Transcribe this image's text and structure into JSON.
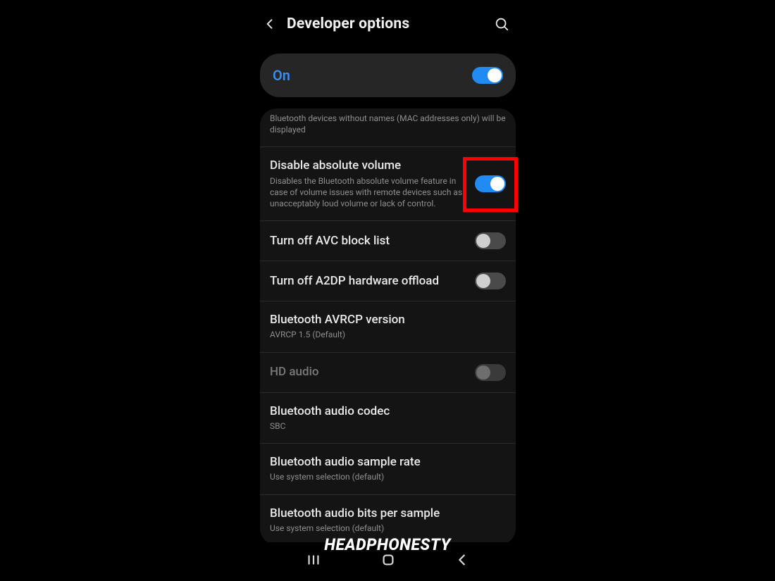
{
  "header": {
    "title": "Developer options"
  },
  "master": {
    "label": "On",
    "on": true
  },
  "rows": {
    "bt_noname_sub": "Bluetooth devices without names (MAC addresses only) will be displayed",
    "disable_abs": {
      "title": "Disable absolute volume",
      "sub": "Disables the Bluetooth absolute volume feature in case of volume issues with remote devices such as unacceptably loud volume or lack of control."
    },
    "avc": {
      "title": "Turn off AVC block list"
    },
    "a2dp": {
      "title": "Turn off A2DP hardware offload"
    },
    "avrcp": {
      "title": "Bluetooth AVRCP version",
      "sub": "AVRCP 1.5 (Default)"
    },
    "hd": {
      "title": "HD audio"
    },
    "codec": {
      "title": "Bluetooth audio codec",
      "sub": "SBC"
    },
    "sample": {
      "title": "Bluetooth audio sample rate",
      "sub": "Use system selection (default)"
    },
    "bits": {
      "title": "Bluetooth audio bits per sample",
      "sub": "Use system selection (default)"
    }
  },
  "watermark": "HEADPHONESTY"
}
